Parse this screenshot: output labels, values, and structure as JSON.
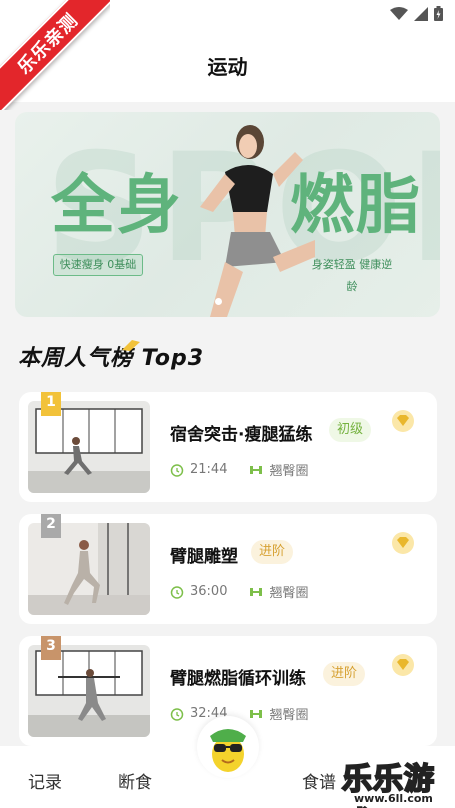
{
  "ribbon": {
    "text": "乐乐亲测"
  },
  "header": {
    "title": "运动"
  },
  "banner": {
    "bg_text": "SPORT",
    "left_title": "全身",
    "right_title": "燃脂",
    "left_tag": "快速瘦身  0基础",
    "right_tag": "身姿轻盈  健康逆龄",
    "accent_color": "#5fb37c"
  },
  "section": {
    "title": "本周人气榜 Top3"
  },
  "courses": [
    {
      "rank": "1",
      "title": "宿舍突击·瘦腿猛练",
      "level": "初级",
      "duration": "21:44",
      "equipment": "翘臀圈",
      "rank_color": "#f2c23a"
    },
    {
      "rank": "2",
      "title": "臂腿雕塑",
      "level": "进阶",
      "duration": "36:00",
      "equipment": "翘臀圈",
      "rank_color": "#a9a9a9"
    },
    {
      "rank": "3",
      "title": "臂腿燃脂循环训练",
      "level": "进阶",
      "duration": "32:44",
      "equipment": "翘臀圈",
      "rank_color": "#c8946a"
    }
  ],
  "nav": {
    "items": [
      {
        "label": "记录"
      },
      {
        "label": "断食"
      },
      {
        "label": "食谱"
      }
    ],
    "center_icon": "mascot-icon"
  },
  "watermark": {
    "text": "乐乐游戏",
    "url": "www.6ll.com"
  }
}
